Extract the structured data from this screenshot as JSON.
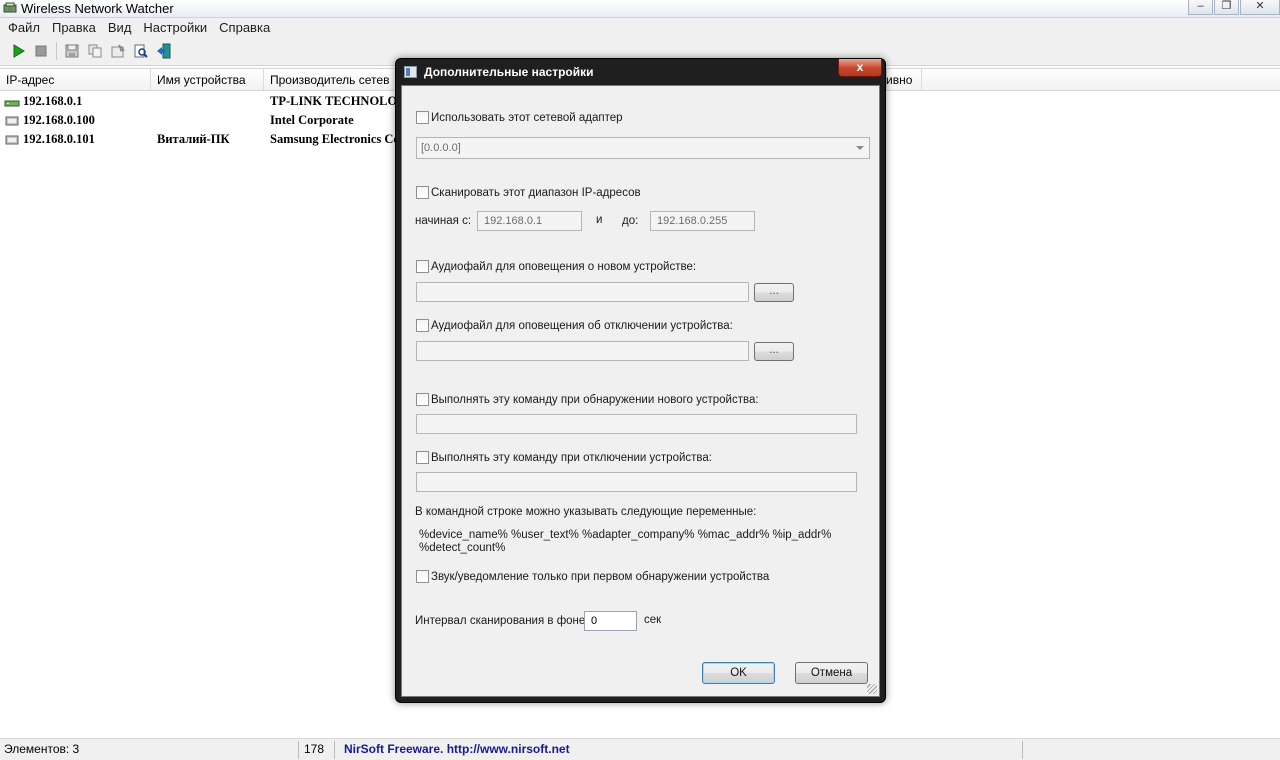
{
  "window": {
    "title": "Wireless Network Watcher",
    "controls": {
      "minimize": "–",
      "maximize": "❐",
      "close": "✕"
    }
  },
  "menu": [
    "Файл",
    "Правка",
    "Вид",
    "Настройки",
    "Справка"
  ],
  "toolbar": {
    "icons": [
      "play-icon",
      "stop-icon",
      "save-icon",
      "copy-icon",
      "properties-icon",
      "find-icon",
      "exit-icon"
    ]
  },
  "list": {
    "columns": [
      "IP-адрес",
      "Имя устройства",
      "Производитель сетев",
      "",
      "ивно"
    ],
    "rows": [
      {
        "ip": "192.168.0.1",
        "name": "",
        "vendor": "TP-LINK TECHNOLOGI",
        "icon": "router-icon"
      },
      {
        "ip": "192.168.0.100",
        "name": "",
        "vendor": "Intel Corporate",
        "icon": "computer-icon"
      },
      {
        "ip": "192.168.0.101",
        "name": "Виталий-ПК",
        "vendor": "Samsung Electronics Co",
        "icon": "computer-icon"
      }
    ]
  },
  "status": {
    "items": "Элементов: 3",
    "count": "178",
    "credit": "NirSoft Freeware.  http://www.nirsoft.net"
  },
  "dialog": {
    "title": "Дополнительные настройки",
    "close": "x",
    "use_adapter": "Использовать этот сетевой адаптер",
    "adapter_value": "[0.0.0.0]",
    "scan_range": "Сканировать этот диапазон IP-адресов",
    "from_label": "начиная с:",
    "from_value": "192.168.0.1",
    "and_label": "и",
    "to_label": "до:",
    "to_value": "192.168.0.255",
    "audio_new": "Аудиофайл для оповещения о новом устройстве:",
    "audio_disconnect": "Аудиофайл для оповещения об отключении устройства:",
    "browse": "...",
    "cmd_new": "Выполнять эту команду при обнаружении нового устройства:",
    "cmd_disconnect": "Выполнять эту команду при отключении устройства:",
    "vars_info": "В командной строке можно указывать следующие переменные:",
    "vars_line1": "%device_name%  %user_text%  %adapter_company%  %mac_addr%  %ip_addr%",
    "vars_line2": "%detect_count%",
    "first_only": "Звук/уведомление только при первом обнаружении устройства",
    "interval_label": "Интервал сканирования в фоне:",
    "interval_value": "0",
    "interval_unit": "сек",
    "ok": "OK",
    "cancel": "Отмена"
  },
  "colors": {
    "dialog_frame": "#1f1f1f",
    "close_button": "#c7462b",
    "ok_focus": "#3c7fb1",
    "status_link": "#1a1a8c"
  }
}
